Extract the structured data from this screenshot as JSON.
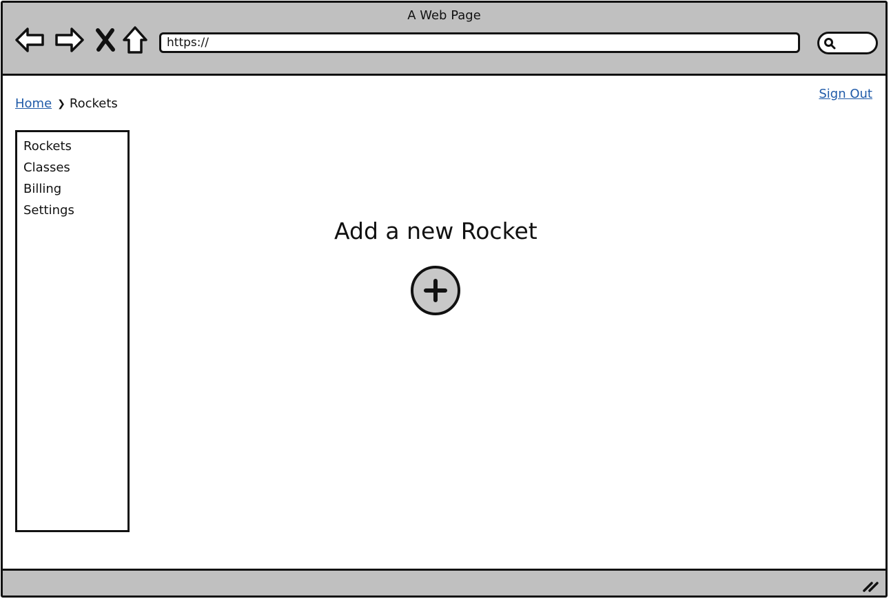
{
  "window": {
    "title": "A Web Page"
  },
  "toolbar": {
    "back_icon": "back-arrow-icon",
    "forward_icon": "forward-arrow-icon",
    "stop_icon": "close-icon",
    "home_icon": "home-icon",
    "url_value": "https://",
    "search_icon": "search-icon"
  },
  "header": {
    "breadcrumb": {
      "home": "Home",
      "separator_icon": "chevron-right-icon",
      "current": "Rockets"
    },
    "sign_out": "Sign Out"
  },
  "sidebar": {
    "items": [
      {
        "label": "Rockets"
      },
      {
        "label": "Classes"
      },
      {
        "label": "Billing"
      },
      {
        "label": "Settings"
      }
    ]
  },
  "main": {
    "heading": "Add a new Rocket",
    "add_icon": "plus-icon"
  },
  "colors": {
    "chrome": "#c0c0c0",
    "link": "#1f5aa8",
    "outline": "#111111",
    "button_fill": "#c8c8c8"
  }
}
